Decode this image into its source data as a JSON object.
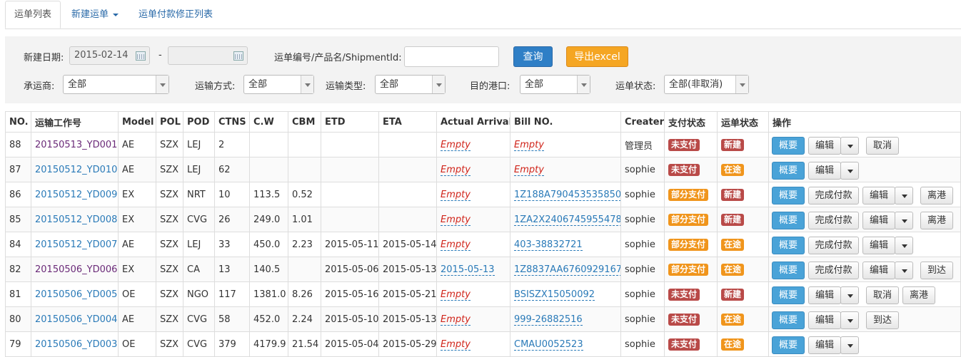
{
  "tabs": [
    "运单列表",
    "新建运单",
    "运单付款修正列表"
  ],
  "filters": {
    "date_label": "新建日期:",
    "date_from": "2015-02-14",
    "date_sep": "-",
    "date_to": "",
    "keyword_label": "运单编号/产品名/ShipmentId:",
    "keyword_value": "",
    "query_button": "查询",
    "export_button": "导出excel",
    "carrier_label": "承运商:",
    "carrier_value": "全部",
    "transport_label": "运输方式:",
    "transport_value": "全部",
    "type_label": "运输类型:",
    "type_value": "全部",
    "port_label": "目的港口:",
    "port_value": "全部",
    "status_label": "运单状态:",
    "status_value": "全部(非取消)"
  },
  "columns": [
    "NO.",
    "运输工作号",
    "Model",
    "POL",
    "POD",
    "CTNS",
    "C.W",
    "CBM",
    "ETD",
    "ETA",
    "Actual Arrival",
    "Bill NO.",
    "Creater",
    "支付状态",
    "运单状态",
    "操作"
  ],
  "rows": [
    {
      "no": "88",
      "job": "20150513_YD001",
      "visited": true,
      "model": "AE",
      "pol": "SZX",
      "pod": "LEJ",
      "ctns": "2",
      "cw": "",
      "cbm": "",
      "etd": "",
      "eta": "",
      "arrival": "Empty",
      "bill": "Empty",
      "creater": "管理员",
      "pay": "未支付",
      "pay_color": "red",
      "status": "新建",
      "status_color": "red",
      "ops": [
        "概要",
        "编辑",
        "▾",
        "取消"
      ]
    },
    {
      "no": "87",
      "job": "20150512_YD010",
      "visited": false,
      "model": "AE",
      "pol": "SZX",
      "pod": "LEJ",
      "ctns": "62",
      "cw": "",
      "cbm": "",
      "etd": "",
      "eta": "",
      "arrival": "Empty",
      "bill": "Empty",
      "creater": "sophie",
      "pay": "未支付",
      "pay_color": "red",
      "status": "在途",
      "status_color": "orange",
      "ops": [
        "概要",
        "编辑",
        "▾"
      ]
    },
    {
      "no": "86",
      "job": "20150512_YD009",
      "visited": false,
      "model": "EX",
      "pol": "SZX",
      "pod": "NRT",
      "ctns": "10",
      "cw": "113.5",
      "cbm": "0.52",
      "etd": "",
      "eta": "",
      "arrival": "Empty",
      "bill": "1Z188A790453535850",
      "creater": "sophie",
      "pay": "部分支付",
      "pay_color": "orange",
      "status": "新建",
      "status_color": "red",
      "ops": [
        "概要",
        "完成付款",
        "编辑",
        "▾",
        "离港"
      ]
    },
    {
      "no": "85",
      "job": "20150512_YD008",
      "visited": false,
      "model": "EX",
      "pol": "SZX",
      "pod": "CVG",
      "ctns": "26",
      "cw": "249.0",
      "cbm": "1.01",
      "etd": "",
      "eta": "",
      "arrival": "Empty",
      "bill": "1ZA2X2406745955478",
      "creater": "sophie",
      "pay": "部分支付",
      "pay_color": "orange",
      "status": "新建",
      "status_color": "red",
      "ops": [
        "概要",
        "完成付款",
        "编辑",
        "▾",
        "离港"
      ]
    },
    {
      "no": "84",
      "job": "20150512_YD007",
      "visited": false,
      "model": "AE",
      "pol": "SZX",
      "pod": "LEJ",
      "ctns": "33",
      "cw": "450.0",
      "cbm": "2.23",
      "etd": "2015-05-11",
      "eta": "2015-05-14",
      "arrival": "Empty",
      "bill": "403-38832721",
      "creater": "sophie",
      "pay": "部分支付",
      "pay_color": "orange",
      "status": "在途",
      "status_color": "orange",
      "ops": [
        "概要",
        "完成付款",
        "编辑",
        "▾"
      ]
    },
    {
      "no": "82",
      "job": "20150506_YD006",
      "visited": true,
      "model": "EX",
      "pol": "SZX",
      "pod": "CA",
      "ctns": "13",
      "cw": "140.5",
      "cbm": "",
      "etd": "2015-05-06",
      "eta": "2015-05-13",
      "arrival": "2015-05-13",
      "bill": "1Z8837AA6760929167",
      "creater": "sophie",
      "pay": "部分支付",
      "pay_color": "orange",
      "status": "在途",
      "status_color": "orange",
      "ops": [
        "概要",
        "完成付款",
        "编辑",
        "▾",
        "到达"
      ]
    },
    {
      "no": "81",
      "job": "20150506_YD005",
      "visited": false,
      "model": "OE",
      "pol": "SZX",
      "pod": "NGO",
      "ctns": "117",
      "cw": "1381.0",
      "cbm": "8.26",
      "etd": "2015-05-16",
      "eta": "2015-05-21",
      "arrival": "Empty",
      "bill": "BSISZX15050092",
      "creater": "sophie",
      "pay": "未支付",
      "pay_color": "red",
      "status": "新建",
      "status_color": "red",
      "ops": [
        "概要",
        "编辑",
        "▾",
        "取消",
        "离港"
      ]
    },
    {
      "no": "80",
      "job": "20150506_YD004",
      "visited": false,
      "model": "AE",
      "pol": "SZX",
      "pod": "CVG",
      "ctns": "58",
      "cw": "452.0",
      "cbm": "2.24",
      "etd": "2015-05-10",
      "eta": "2015-05-13",
      "arrival": "Empty",
      "bill": "999-26882516",
      "creater": "sophie",
      "pay": "未支付",
      "pay_color": "red",
      "status": "在途",
      "status_color": "orange",
      "ops": [
        "概要",
        "编辑",
        "▾",
        "到达"
      ]
    },
    {
      "no": "79",
      "job": "20150506_YD003",
      "visited": false,
      "model": "OE",
      "pol": "SZX",
      "pod": "CVG",
      "ctns": "379",
      "cw": "4179.9",
      "cbm": "21.54",
      "etd": "2015-05-04",
      "eta": "2015-05-29",
      "arrival": "Empty",
      "bill": "CMAU0052523",
      "creater": "sophie",
      "pay": "未支付",
      "pay_color": "red",
      "status": "在途",
      "status_color": "orange",
      "ops": [
        "概要",
        "编辑",
        "▾"
      ]
    }
  ]
}
